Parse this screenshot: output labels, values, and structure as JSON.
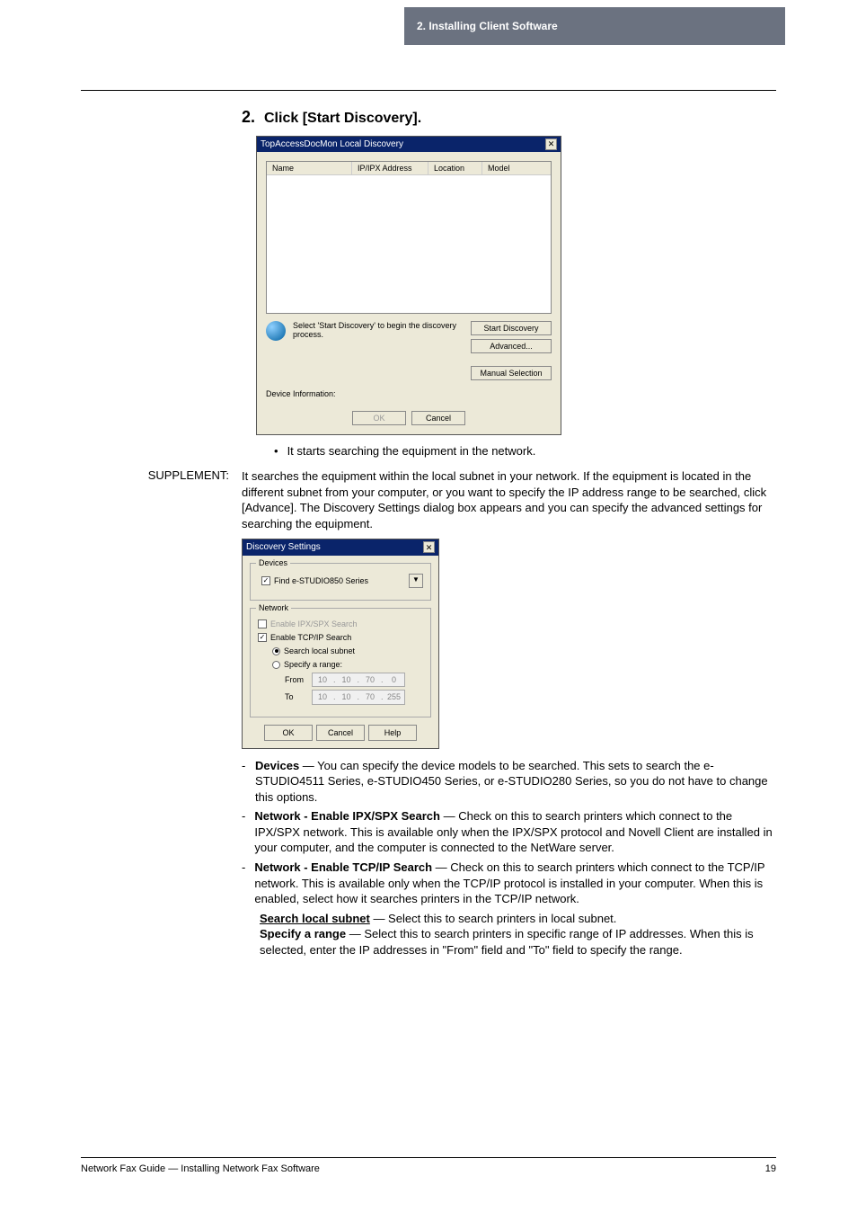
{
  "header": {
    "chapter": "2. Installing Client Software"
  },
  "step": {
    "num": "2.",
    "text": "Click [Start Discovery]."
  },
  "dialog1": {
    "title": "TopAccessDocMon Local Discovery",
    "cols": {
      "name": "Name",
      "addr": "IP/IPX Address",
      "loc": "Location",
      "model": "Model"
    },
    "hint": "Select 'Start Discovery' to begin the discovery process.",
    "btn_start": "Start Discovery",
    "btn_adv": "Advanced...",
    "btn_manual": "Manual Selection",
    "dev_info": "Device Information:",
    "ok": "OK",
    "cancel": "Cancel"
  },
  "bullet": "It starts searching the equipment in the network.",
  "supp": {
    "label": "SUPPLEMENT:",
    "para": "It searches the equipment within the local subnet in your network.  If the equipment is located in the different subnet from your computer, or you want to specify the IP address range to be searched, click [Advance].  The Discovery Settings dialog box appears and you can specify the advanced settings for searching the equipment."
  },
  "dialog2": {
    "title": "Discovery Settings",
    "fs_devices": "Devices",
    "find_lbl": "Find e-STUDIO850 Series",
    "fs_network": "Network",
    "ipx_lbl": "Enable IPX/SPX Search",
    "tcp_lbl": "Enable TCP/IP Search",
    "local_lbl": "Search local subnet",
    "range_lbl": "Specify a range:",
    "from": "From",
    "to": "To",
    "ip_from": [
      "10",
      "10",
      "70",
      "0"
    ],
    "ip_to": [
      "10",
      "10",
      "70",
      "255"
    ],
    "ok": "OK",
    "cancel": "Cancel",
    "help": "Help"
  },
  "list": {
    "devices_b": "Devices",
    "devices": " — You can specify the device models to be searched.  This sets to search the e-STUDIO4511 Series, e-STUDIO450 Series, or e-STUDIO280 Series, so you do not have to change this options.",
    "ipx_b": "Network - Enable IPX/SPX Search",
    "ipx": " — Check on this to search printers which connect to the IPX/SPX network.  This is available only when the IPX/SPX protocol and Novell Client are installed in your computer, and the computer is connected to the NetWare server.",
    "tcp_b": "Network - Enable TCP/IP Search",
    "tcp": " — Check on this to search printers which connect to the TCP/IP network.  This is available only when the TCP/IP protocol is installed in your computer.  When this is enabled, select how it searches printers in the TCP/IP network.",
    "local_u": "Search local subnet",
    "local": " — Select this to search printers in local subnet.",
    "range_b": "Specify a range",
    "range": " — Select this to search printers in specific range of IP addresses.  When this is selected, enter the IP addresses in \"From\" field and \"To\" field to specify the range."
  },
  "footer": {
    "left": "Network Fax Guide — Installing Network Fax Software",
    "page": "19"
  }
}
